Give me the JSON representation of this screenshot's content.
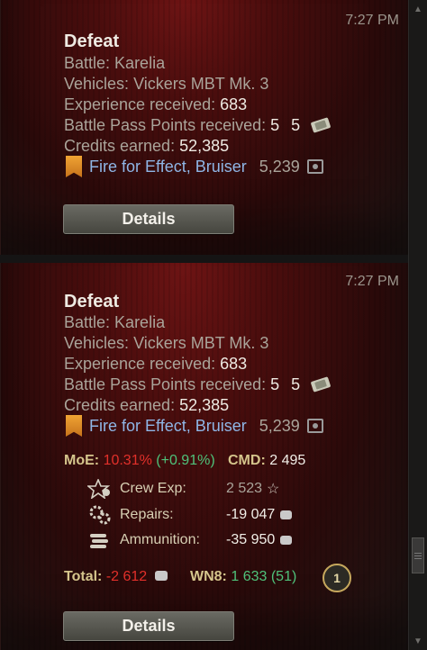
{
  "cards": [
    {
      "time": "7:27 PM",
      "title": "Defeat",
      "battle_label": "Battle:",
      "battle_value": "Karelia",
      "vehicles_label": "Vehicles:",
      "vehicles_value": "Vickers MBT Mk. 3",
      "exp_label": "Experience received:",
      "exp_value": "683",
      "bp_label": "Battle Pass Points received:",
      "bp_value": "5",
      "bp_value2": "5",
      "credits_label": "Credits earned:",
      "credits_value": "52,385",
      "award_name": "Fire for Effect, Bruiser",
      "award_amount": "5,239",
      "details_label": "Details"
    },
    {
      "time": "7:27 PM",
      "title": "Defeat",
      "battle_label": "Battle:",
      "battle_value": "Karelia",
      "vehicles_label": "Vehicles:",
      "vehicles_value": "Vickers MBT Mk. 3",
      "exp_label": "Experience received:",
      "exp_value": "683",
      "bp_label": "Battle Pass Points received:",
      "bp_value": "5",
      "bp_value2": "5",
      "credits_label": "Credits earned:",
      "credits_value": "52,385",
      "award_name": "Fire for Effect, Bruiser",
      "award_amount": "5,239",
      "moe_label": "MoE:",
      "moe_value": "10.31%",
      "moe_delta": "(+0.91%)",
      "cmd_label": "CMD:",
      "cmd_value": "2 495",
      "crew_label": "Crew Exp:",
      "crew_value": "2 523",
      "repairs_label": "Repairs:",
      "repairs_value": "-19 047",
      "ammo_label": "Ammunition:",
      "ammo_value": "-35 950",
      "total_label": "Total:",
      "total_value": "-2 612",
      "wn8_label": "WN8:",
      "wn8_value": "1 633",
      "wn8_delta": "(51)",
      "badge_value": "1",
      "details_label": "Details"
    }
  ],
  "icons": {
    "premium_ticket": "ticket-icon",
    "credits": "credits-icon",
    "award": "ribbon-icon",
    "crew": "crew-star-icon",
    "repairs": "gears-icon",
    "ammo": "ammo-icon",
    "coin": "coin-icon",
    "badge": "mastery-badge-icon"
  },
  "colors": {
    "accent_red": "#e2302a",
    "accent_green": "#4fc27a",
    "award_blue": "#8fb6e6",
    "label_gold": "#d5c58c"
  }
}
